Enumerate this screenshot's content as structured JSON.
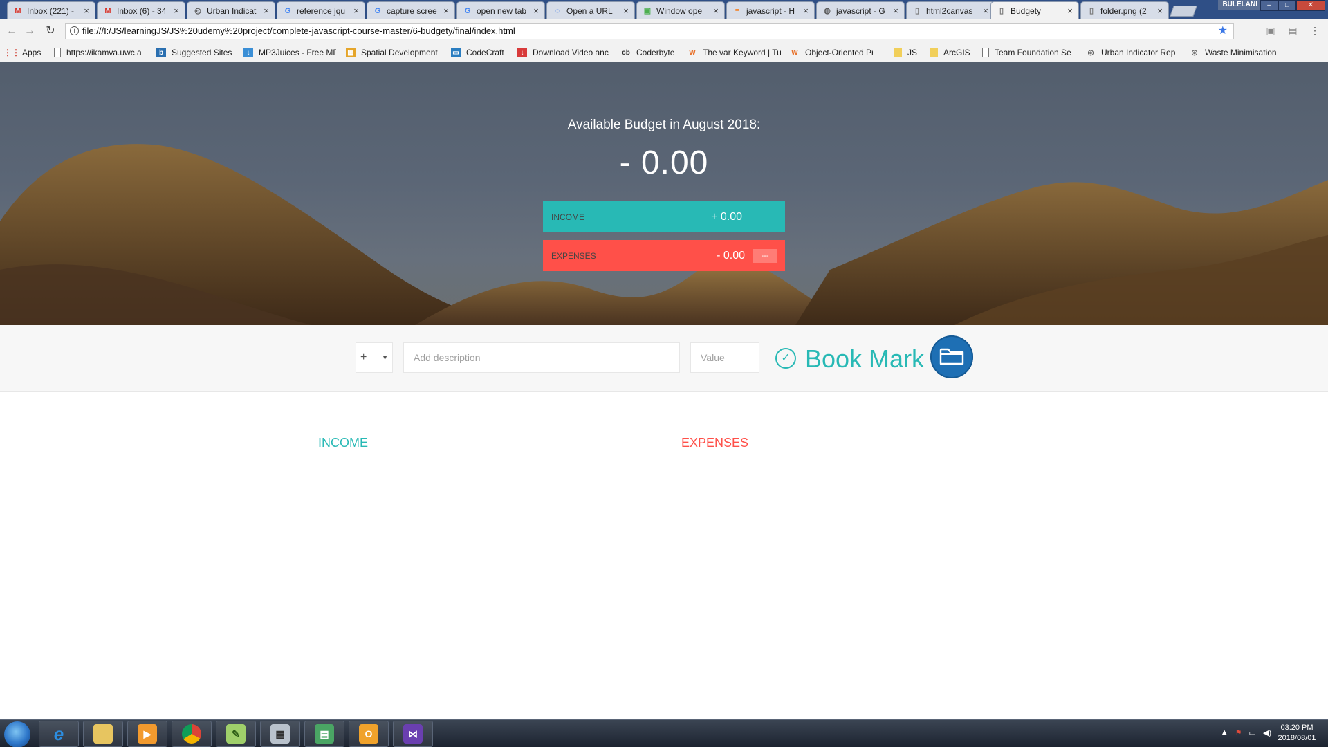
{
  "browser": {
    "tabs": [
      {
        "label": "Inbox (221) - ",
        "icon": "gmail-icon"
      },
      {
        "label": "Inbox (6) - 34",
        "icon": "gmail-icon"
      },
      {
        "label": "Urban Indicat",
        "icon": "site-icon"
      },
      {
        "label": "reference jqu",
        "icon": "google-icon"
      },
      {
        "label": "capture scree",
        "icon": "google-icon"
      },
      {
        "label": "open new tab",
        "icon": "google-icon"
      },
      {
        "label": "Open a URL",
        "icon": "loading-icon"
      },
      {
        "label": "Window ope",
        "icon": "site-icon"
      },
      {
        "label": "javascript - H",
        "icon": "stackoverflow-icon"
      },
      {
        "label": "javascript - G",
        "icon": "globe-icon"
      },
      {
        "label": "html2canvas",
        "icon": "page-icon"
      },
      {
        "label": "Budgety",
        "icon": "page-icon"
      },
      {
        "label": "folder.png (2",
        "icon": "page-icon"
      }
    ],
    "active_tab": "Budgety",
    "profile": "BULELANI",
    "url": "file:///I:/JS/learningJS/JS%20udemy%20project/complete-javascript-course-master/6-budgety/final/index.html",
    "bookmarks": [
      {
        "label": "Apps",
        "icon": "apps-grid-icon"
      },
      {
        "label": "https://ikamva.uwc.a",
        "icon": "page-icon"
      },
      {
        "label": "Suggested Sites",
        "icon": "bing-icon"
      },
      {
        "label": "MP3Juices - Free MP",
        "icon": "download-icon"
      },
      {
        "label": "Spatial Development",
        "icon": "site-icon"
      },
      {
        "label": "CodeCraft",
        "icon": "codecraft-icon"
      },
      {
        "label": "Download Video anc",
        "icon": "download-icon"
      },
      {
        "label": "Coderbyte",
        "icon": "coderbyte-icon"
      },
      {
        "label": "The var Keyword | Tu",
        "icon": "w3-icon"
      },
      {
        "label": "Object-Oriented Pro",
        "icon": "w3-icon"
      },
      {
        "label": "JS",
        "icon": "folder-icon"
      },
      {
        "label": "ArcGIS",
        "icon": "folder-icon"
      },
      {
        "label": "Team Foundation Se",
        "icon": "page-icon"
      },
      {
        "label": "Urban Indicator Rep",
        "icon": "site-icon"
      },
      {
        "label": "Waste Minimisation",
        "icon": "site-icon"
      }
    ]
  },
  "app": {
    "budget_title": "Available Budget in August 2018:",
    "budget_value": "- 0.00",
    "income_label": "Income",
    "income_value": "+ 0.00",
    "expenses_label": "Expenses",
    "expenses_value": "- 0.00",
    "expenses_percentage": "---",
    "add_type": "+",
    "add_description_placeholder": "Add description",
    "add_value_placeholder": "Value",
    "bookmark_label": "Book Mark",
    "income_column_title": "Income",
    "expenses_column_title": "Expenses",
    "colors": {
      "income": "#28b9b5",
      "expenses": "#ff5049",
      "folder": "#1e6fb4"
    }
  },
  "taskbar": {
    "apps": [
      "internet-explorer-icon",
      "file-explorer-icon",
      "media-player-icon",
      "chrome-icon",
      "notepad-plus-icon",
      "calculator-icon",
      "project-icon",
      "outlook-icon",
      "visual-studio-icon"
    ],
    "time": "03:20 PM",
    "date": "2018/08/01"
  }
}
